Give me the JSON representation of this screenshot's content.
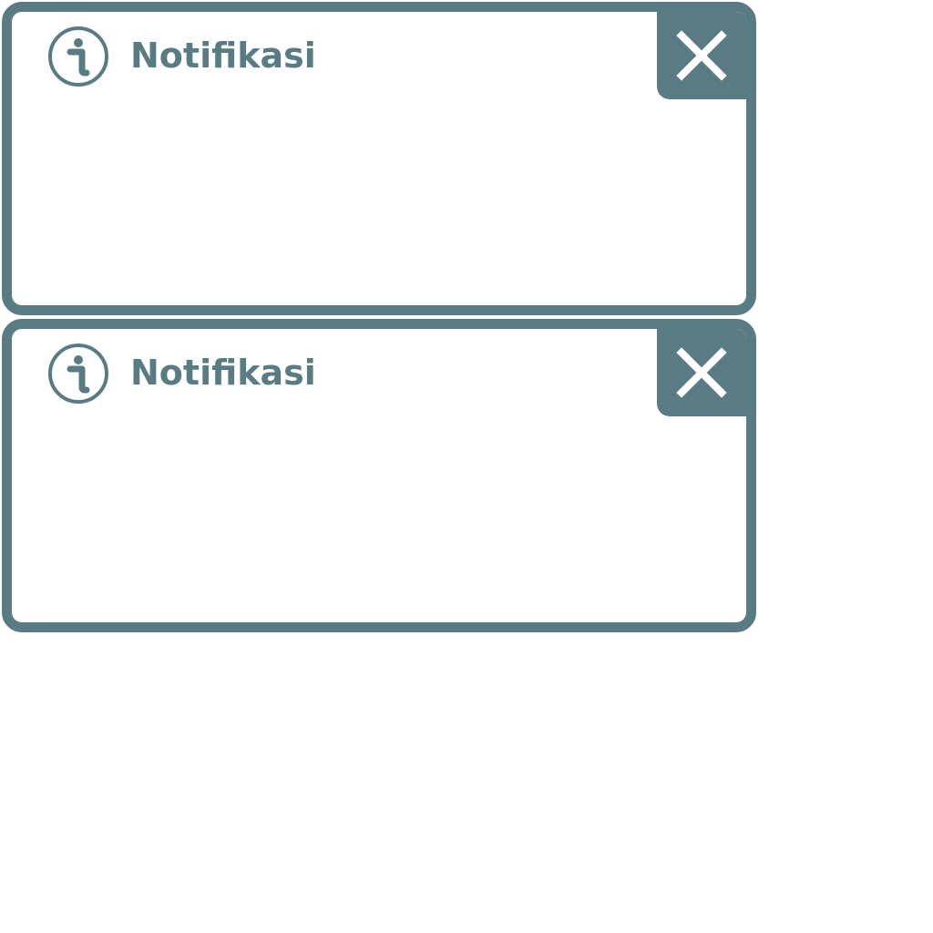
{
  "theme": {
    "accent": "#597c84",
    "background": "#ffffff"
  },
  "notifications": [
    {
      "title": "Notifikasi",
      "icon": "info-icon",
      "close_icon": "close-icon"
    },
    {
      "title": "Notifikasi",
      "icon": "info-icon",
      "close_icon": "close-icon"
    }
  ]
}
